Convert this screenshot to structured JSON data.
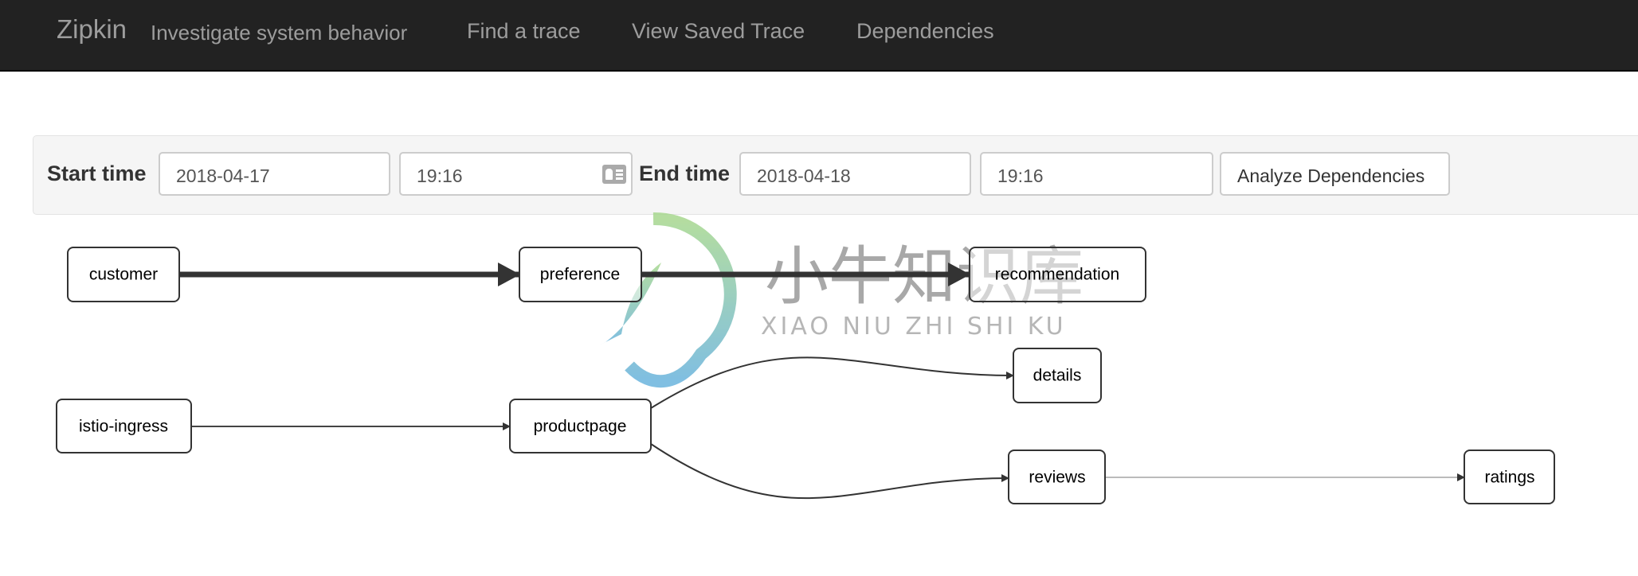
{
  "navbar": {
    "brand": "Zipkin",
    "tagline": "Investigate system behavior",
    "links": [
      "Find a trace",
      "View Saved Trace",
      "Dependencies"
    ]
  },
  "filters": {
    "start_label": "Start time",
    "start_date": "2018-04-17",
    "start_time": "19:16",
    "end_label": "End time",
    "end_date": "2018-04-18",
    "end_time": "19:16",
    "analyze_button": "Analyze Dependencies",
    "calendar_icon": "calendar-card-icon"
  },
  "graph": {
    "nodes": [
      "customer",
      "preference",
      "recommendation",
      "istio-ingress",
      "productpage",
      "details",
      "reviews",
      "ratings"
    ],
    "edges": [
      {
        "from": "customer",
        "to": "preference",
        "weight": "heavy"
      },
      {
        "from": "preference",
        "to": "recommendation",
        "weight": "heavy"
      },
      {
        "from": "istio-ingress",
        "to": "productpage",
        "weight": "light"
      },
      {
        "from": "productpage",
        "to": "details",
        "weight": "light"
      },
      {
        "from": "productpage",
        "to": "reviews",
        "weight": "light"
      },
      {
        "from": "reviews",
        "to": "ratings",
        "weight": "faint"
      }
    ]
  },
  "watermark": {
    "text_cn": "小牛知识库",
    "text_latin": "XIAO NIU ZHI SHI KU"
  }
}
